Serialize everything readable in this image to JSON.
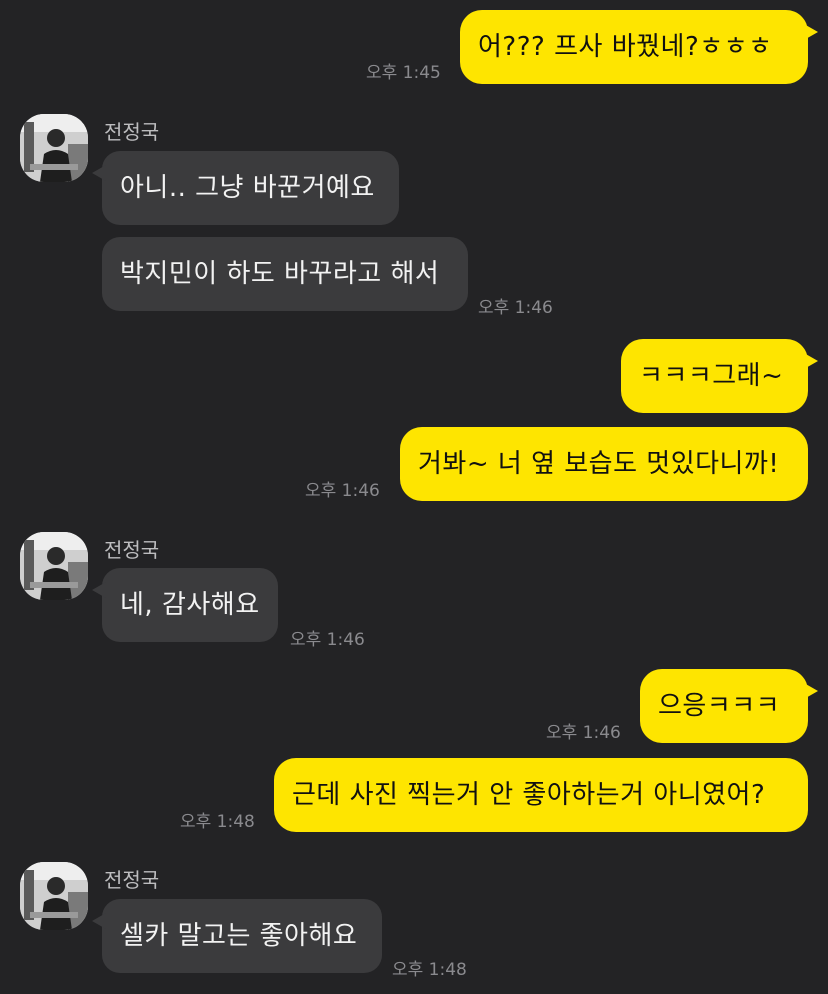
{
  "colors": {
    "background": "#232325",
    "outgoing_bubble": "#FEE500",
    "incoming_bubble": "#3B3B3D",
    "timestamp": "#8A8A8E"
  },
  "contact": {
    "name": "전정국",
    "avatar_icon": "profile-photo-icon"
  },
  "messages": [
    {
      "id": "m1",
      "direction": "outgoing",
      "text": "어??? 프사 바꿨네?ㅎㅎㅎ",
      "time": "오후 1:45"
    },
    {
      "id": "m2",
      "direction": "incoming",
      "text": "아니.. 그냥 바꾼거예요",
      "time": ""
    },
    {
      "id": "m3",
      "direction": "incoming",
      "text": "박지민이 하도 바꾸라고 해서",
      "time": "오후 1:46"
    },
    {
      "id": "m4",
      "direction": "outgoing",
      "text": "ㅋㅋㅋ그래~",
      "time": ""
    },
    {
      "id": "m5",
      "direction": "outgoing",
      "text": "거봐~ 너 옆 보습도 멋있다니까!",
      "time": "오후 1:46"
    },
    {
      "id": "m6",
      "direction": "incoming",
      "text": "네, 감사해요",
      "time": "오후 1:46"
    },
    {
      "id": "m7",
      "direction": "outgoing",
      "text": "으응ㅋㅋㅋ",
      "time": "오후 1:46"
    },
    {
      "id": "m8",
      "direction": "outgoing",
      "text": "근데 사진 찍는거 안 좋아하는거 아니였어?",
      "time": "오후 1:48"
    },
    {
      "id": "m9",
      "direction": "incoming",
      "text": "셀카 말고는 좋아해요",
      "time": "오후 1:48"
    }
  ]
}
